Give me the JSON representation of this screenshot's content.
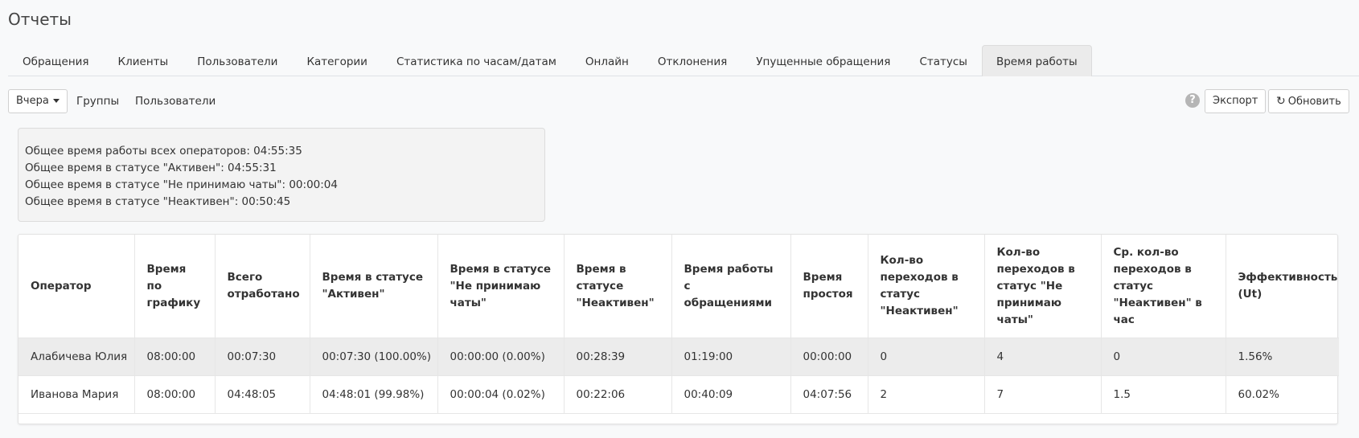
{
  "page": {
    "title": "Отчеты"
  },
  "tabs": [
    {
      "label": "Обращения"
    },
    {
      "label": "Клиенты"
    },
    {
      "label": "Пользователи"
    },
    {
      "label": "Категории"
    },
    {
      "label": "Статистика по часам/датам"
    },
    {
      "label": "Онлайн"
    },
    {
      "label": "Отклонения"
    },
    {
      "label": "Упущенные обращения"
    },
    {
      "label": "Статусы"
    },
    {
      "label": "Время работы",
      "active": true
    }
  ],
  "toolbar": {
    "period_selected": "Вчера",
    "groups_label": "Группы",
    "users_label": "Пользователи",
    "help_glyph": "?",
    "export_label": "Экспорт",
    "refresh_label": "Обновить",
    "refresh_icon": "refresh-icon"
  },
  "summary": {
    "lines": [
      "Общее время работы всех операторов: 04:55:35",
      "Общее время в статусе \"Активен\": 04:55:31",
      "Общее время в статусе \"Не принимаю чаты\": 00:00:04",
      "Общее время в статусе \"Неактивен\": 00:50:45"
    ]
  },
  "table": {
    "headers": [
      "Оператор",
      "Время по графику",
      "Всего отработано",
      "Время в статусе \"Активен\"",
      "Время в статусе \"Не принимаю чаты\"",
      "Время в статусе \"Неактивен\"",
      "Время работы с обращениями",
      "Время простоя",
      "Кол-во переходов в статус \"Неактивен\"",
      "Кол-во переходов в статус \"Не принимаю чаты\"",
      "Ср. кол-во переходов в статус \"Неактивен\" в час",
      "Эффективность (Ut)"
    ],
    "rows": [
      [
        "Алабичева Юлия",
        "08:00:00",
        "00:07:30",
        "00:07:30 (100.00%)",
        "00:00:00 (0.00%)",
        "00:28:39",
        "01:19:00",
        "00:00:00",
        "0",
        "4",
        "0",
        "1.56%"
      ],
      [
        "Иванова Мария",
        "08:00:00",
        "04:48:05",
        "04:48:01 (99.98%)",
        "00:00:04 (0.02%)",
        "00:22:06",
        "00:40:09",
        "04:07:56",
        "2",
        "7",
        "1.5",
        "60.02%"
      ]
    ]
  },
  "colors": {
    "page_bg": "#f8f9fa",
    "active_tab_bg": "#ebebeb",
    "highlight_row_bg": "#ececec"
  }
}
